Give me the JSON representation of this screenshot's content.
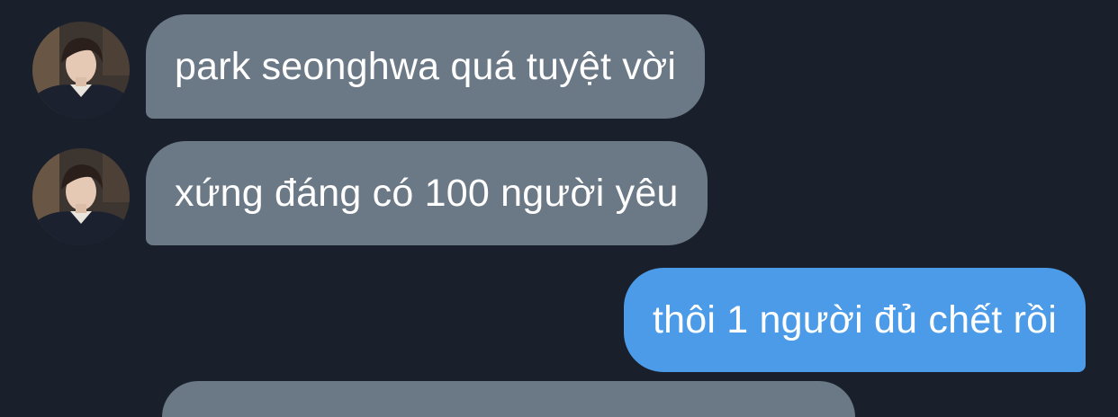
{
  "messages": [
    {
      "direction": "incoming",
      "text": "park seonghwa quá tuyệt vời",
      "avatar": "user-avatar-photo"
    },
    {
      "direction": "incoming",
      "text": "xứng đáng có 100 người yêu",
      "avatar": "user-avatar-photo"
    },
    {
      "direction": "outgoing",
      "text": "thôi 1 người đủ chết rồi"
    }
  ],
  "colors": {
    "background": "#19202b",
    "incoming_bubble": "#6b7986",
    "outgoing_bubble": "#4c9be8",
    "text": "#ffffff"
  }
}
